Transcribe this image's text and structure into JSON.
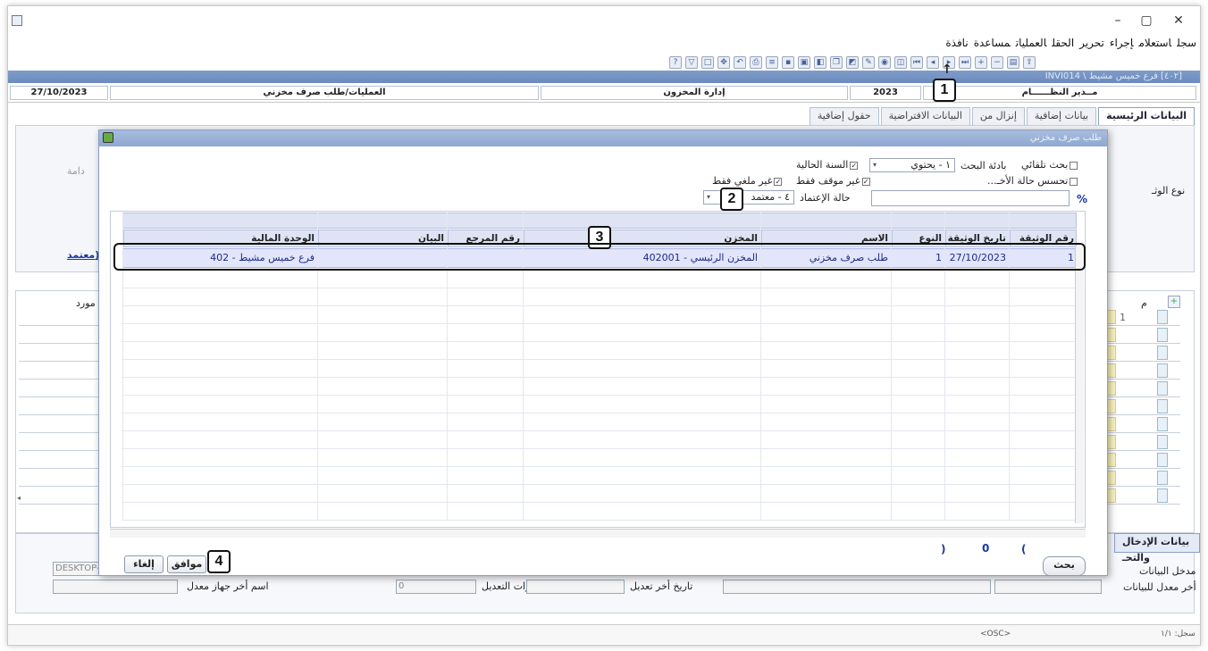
{
  "window": {
    "menu": [
      "سجل",
      "استعلام",
      "إجراء",
      "تحرير",
      "الحقل",
      "العمليات",
      "مساعدة",
      "نافذة"
    ],
    "controls": {
      "minimize": "–",
      "maximize": "▢",
      "close": "✕"
    }
  },
  "inner_title": "[٤٠٢] فرع خميس مشيط \\ INVI014",
  "info_bar": {
    "date": "27/10/2023",
    "path": "العمليات/طلب صرف مخزني",
    "department": "إدارة المخزون",
    "year": "2023",
    "user": "مــدير النظــــــام"
  },
  "tabs": [
    "البيانات الرئيسية",
    "بيانات إضافية",
    "إنزال من",
    "البيانات الافتراضية",
    "حقول إضافية"
  ],
  "background": {
    "label_type": "نوع الوثـ",
    "label_perm": "دامة",
    "link_approved": "معتمد)",
    "col_m": "م",
    "col_supplier": "مورد",
    "row1_m": "1",
    "bottom_tab": "بيانات الإدخال والتحـ",
    "entry_label": "مدخل البيانات",
    "entry_device": "DESKTOP-",
    "last_editor_label": "أخر معدل للبيانات",
    "last_edit_date_label": "تاريخ أخر تعديل",
    "edit_count_label": "مرات التعديل",
    "edit_count": "0",
    "last_device_label": "اسم أخر جهاز معدل",
    "status_center": "<OSC>",
    "status_right": "سجل: ١/١"
  },
  "dialog": {
    "title": "طلب صرف مخزني",
    "auto_search": "بحث تلقائي",
    "search_tool_label": "بادئة البحث",
    "search_tool_value": "١ - يحتوي",
    "current_year": "السنة الحالية",
    "not_stopped": "غير موقف فقط",
    "not_cancelled": "غير ملغي فقط",
    "remember_last": "تحسس حالة الأخـ...",
    "approval_label": "حالة الإعتماد",
    "approval_value": "٤ - معتمد",
    "percent": "%",
    "columns": [
      "رقم الوثيقة",
      "تاريخ الوثيقة",
      "النوع",
      "الاسم",
      "المخزن",
      "رقم المرجع",
      "البيان",
      "الوحدة المالية"
    ],
    "rows": [
      {
        "doc_no": "1",
        "date": "27/10/2023",
        "type": "1",
        "name": "طلب صرف مخزني",
        "store": "المخزن الرئيسي - 402001",
        "ref": "",
        "desc": "",
        "unit": "فرع خميس مشيط - 402"
      }
    ],
    "count_open": "(",
    "count": "0",
    "count_close": ")",
    "search_btn": "بحث",
    "ok_btn": "موافق",
    "cancel_btn": "إلغاء"
  },
  "callouts": [
    "1",
    "2",
    "3",
    "4"
  ]
}
